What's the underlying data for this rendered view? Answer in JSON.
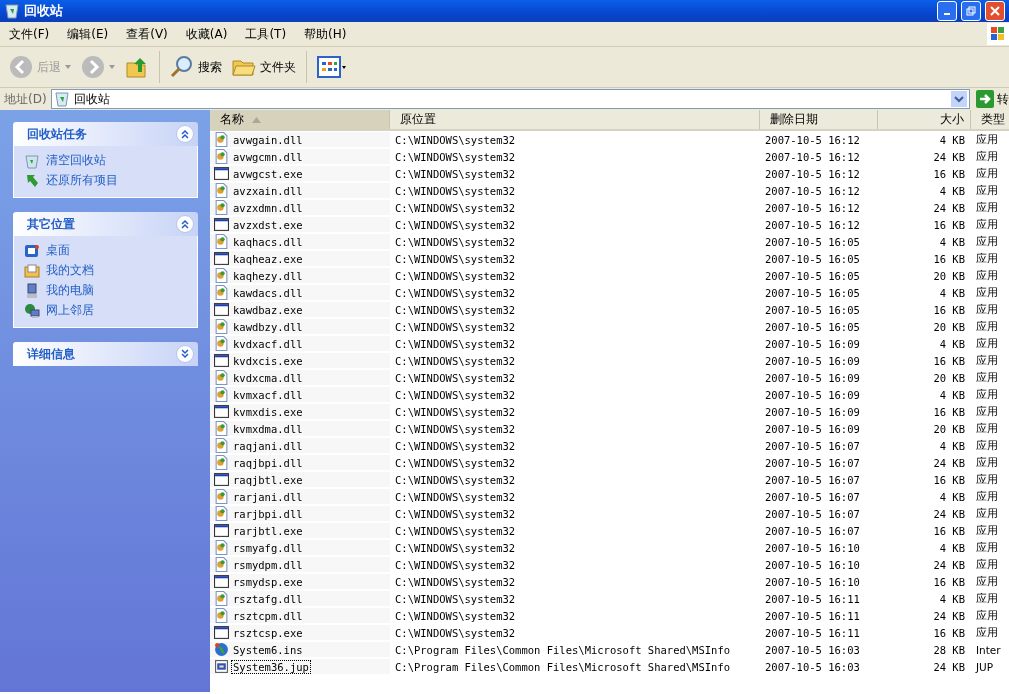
{
  "window": {
    "title": "回收站"
  },
  "menu": [
    "文件(F)",
    "编辑(E)",
    "查看(V)",
    "收藏(A)",
    "工具(T)",
    "帮助(H)"
  ],
  "toolbar": {
    "back": {
      "label": "后退",
      "disabled": true
    },
    "forward": {
      "disabled": true
    },
    "search": "搜索",
    "folders": "文件夹"
  },
  "address": {
    "label": "地址(D)",
    "value": "回收站",
    "go": "转"
  },
  "panels": [
    {
      "title": "回收站任务",
      "expanded": true,
      "items": [
        {
          "label": "清空回收站",
          "kind": "bin"
        },
        {
          "label": "还原所有项目",
          "kind": "restore"
        }
      ]
    },
    {
      "title": "其它位置",
      "expanded": true,
      "items": [
        {
          "label": "桌面",
          "kind": "desktop"
        },
        {
          "label": "我的文档",
          "kind": "documents"
        },
        {
          "label": "我的电脑",
          "kind": "computer"
        },
        {
          "label": "网上邻居",
          "kind": "network"
        }
      ]
    },
    {
      "title": "详细信息",
      "expanded": false
    }
  ],
  "table": {
    "columns": [
      {
        "label": "名称",
        "sorted": true
      },
      {
        "label": "原位置",
        "sorted": false
      },
      {
        "label": "删除日期",
        "sorted": false
      },
      {
        "label": "大小",
        "sorted": false
      },
      {
        "label": "类型",
        "sorted": false
      }
    ],
    "rows": [
      {
        "name": "avwgain.dll",
        "kind": "dll",
        "location": "C:\\WINDOWS\\system32",
        "date": "2007-10-5 16:12",
        "size": "4 KB",
        "type": "应用",
        "selected": false
      },
      {
        "name": "avwgcmn.dll",
        "kind": "dll",
        "location": "C:\\WINDOWS\\system32",
        "date": "2007-10-5 16:12",
        "size": "24 KB",
        "type": "应用",
        "selected": false
      },
      {
        "name": "avwgcst.exe",
        "kind": "exe",
        "location": "C:\\WINDOWS\\system32",
        "date": "2007-10-5 16:12",
        "size": "16 KB",
        "type": "应用",
        "selected": false
      },
      {
        "name": "avzxain.dll",
        "kind": "dll",
        "location": "C:\\WINDOWS\\system32",
        "date": "2007-10-5 16:12",
        "size": "4 KB",
        "type": "应用",
        "selected": false
      },
      {
        "name": "avzxdmn.dll",
        "kind": "dll",
        "location": "C:\\WINDOWS\\system32",
        "date": "2007-10-5 16:12",
        "size": "24 KB",
        "type": "应用",
        "selected": false
      },
      {
        "name": "avzxdst.exe",
        "kind": "exe",
        "location": "C:\\WINDOWS\\system32",
        "date": "2007-10-5 16:12",
        "size": "16 KB",
        "type": "应用",
        "selected": false
      },
      {
        "name": "kaqhacs.dll",
        "kind": "dll",
        "location": "C:\\WINDOWS\\system32",
        "date": "2007-10-5 16:05",
        "size": "4 KB",
        "type": "应用",
        "selected": false
      },
      {
        "name": "kaqheaz.exe",
        "kind": "exe",
        "location": "C:\\WINDOWS\\system32",
        "date": "2007-10-5 16:05",
        "size": "16 KB",
        "type": "应用",
        "selected": false
      },
      {
        "name": "kaqhezy.dll",
        "kind": "dll",
        "location": "C:\\WINDOWS\\system32",
        "date": "2007-10-5 16:05",
        "size": "20 KB",
        "type": "应用",
        "selected": false
      },
      {
        "name": "kawdacs.dll",
        "kind": "dll",
        "location": "C:\\WINDOWS\\system32",
        "date": "2007-10-5 16:05",
        "size": "4 KB",
        "type": "应用",
        "selected": false
      },
      {
        "name": "kawdbaz.exe",
        "kind": "exe",
        "location": "C:\\WINDOWS\\system32",
        "date": "2007-10-5 16:05",
        "size": "16 KB",
        "type": "应用",
        "selected": false
      },
      {
        "name": "kawdbzy.dll",
        "kind": "dll",
        "location": "C:\\WINDOWS\\system32",
        "date": "2007-10-5 16:05",
        "size": "20 KB",
        "type": "应用",
        "selected": false
      },
      {
        "name": "kvdxacf.dll",
        "kind": "dll",
        "location": "C:\\WINDOWS\\system32",
        "date": "2007-10-5 16:09",
        "size": "4 KB",
        "type": "应用",
        "selected": false
      },
      {
        "name": "kvdxcis.exe",
        "kind": "exe",
        "location": "C:\\WINDOWS\\system32",
        "date": "2007-10-5 16:09",
        "size": "16 KB",
        "type": "应用",
        "selected": false
      },
      {
        "name": "kvdxcma.dll",
        "kind": "dll",
        "location": "C:\\WINDOWS\\system32",
        "date": "2007-10-5 16:09",
        "size": "20 KB",
        "type": "应用",
        "selected": false
      },
      {
        "name": "kvmxacf.dll",
        "kind": "dll",
        "location": "C:\\WINDOWS\\system32",
        "date": "2007-10-5 16:09",
        "size": "4 KB",
        "type": "应用",
        "selected": false
      },
      {
        "name": "kvmxdis.exe",
        "kind": "exe",
        "location": "C:\\WINDOWS\\system32",
        "date": "2007-10-5 16:09",
        "size": "16 KB",
        "type": "应用",
        "selected": false
      },
      {
        "name": "kvmxdma.dll",
        "kind": "dll",
        "location": "C:\\WINDOWS\\system32",
        "date": "2007-10-5 16:09",
        "size": "20 KB",
        "type": "应用",
        "selected": false
      },
      {
        "name": "raqjani.dll",
        "kind": "dll",
        "location": "C:\\WINDOWS\\system32",
        "date": "2007-10-5 16:07",
        "size": "4 KB",
        "type": "应用",
        "selected": false
      },
      {
        "name": "raqjbpi.dll",
        "kind": "dll",
        "location": "C:\\WINDOWS\\system32",
        "date": "2007-10-5 16:07",
        "size": "24 KB",
        "type": "应用",
        "selected": false
      },
      {
        "name": "raqjbtl.exe",
        "kind": "exe",
        "location": "C:\\WINDOWS\\system32",
        "date": "2007-10-5 16:07",
        "size": "16 KB",
        "type": "应用",
        "selected": false
      },
      {
        "name": "rarjani.dll",
        "kind": "dll",
        "location": "C:\\WINDOWS\\system32",
        "date": "2007-10-5 16:07",
        "size": "4 KB",
        "type": "应用",
        "selected": false
      },
      {
        "name": "rarjbpi.dll",
        "kind": "dll",
        "location": "C:\\WINDOWS\\system32",
        "date": "2007-10-5 16:07",
        "size": "24 KB",
        "type": "应用",
        "selected": false
      },
      {
        "name": "rarjbtl.exe",
        "kind": "exe",
        "location": "C:\\WINDOWS\\system32",
        "date": "2007-10-5 16:07",
        "size": "16 KB",
        "type": "应用",
        "selected": false
      },
      {
        "name": "rsmyafg.dll",
        "kind": "dll",
        "location": "C:\\WINDOWS\\system32",
        "date": "2007-10-5 16:10",
        "size": "4 KB",
        "type": "应用",
        "selected": false
      },
      {
        "name": "rsmydpm.dll",
        "kind": "dll",
        "location": "C:\\WINDOWS\\system32",
        "date": "2007-10-5 16:10",
        "size": "24 KB",
        "type": "应用",
        "selected": false
      },
      {
        "name": "rsmydsp.exe",
        "kind": "exe",
        "location": "C:\\WINDOWS\\system32",
        "date": "2007-10-5 16:10",
        "size": "16 KB",
        "type": "应用",
        "selected": false
      },
      {
        "name": "rsztafg.dll",
        "kind": "dll",
        "location": "C:\\WINDOWS\\system32",
        "date": "2007-10-5 16:11",
        "size": "4 KB",
        "type": "应用",
        "selected": false
      },
      {
        "name": "rsztcpm.dll",
        "kind": "dll",
        "location": "C:\\WINDOWS\\system32",
        "date": "2007-10-5 16:11",
        "size": "24 KB",
        "type": "应用",
        "selected": false
      },
      {
        "name": "rsztcsp.exe",
        "kind": "exe",
        "location": "C:\\WINDOWS\\system32",
        "date": "2007-10-5 16:11",
        "size": "16 KB",
        "type": "应用",
        "selected": false
      },
      {
        "name": "System6.ins",
        "kind": "ins",
        "location": "C:\\Program Files\\Common Files\\Microsoft Shared\\MSInfo",
        "date": "2007-10-5 16:03",
        "size": "28 KB",
        "type": "Inter",
        "selected": false
      },
      {
        "name": "System36.jup",
        "kind": "jup",
        "location": "C:\\Program Files\\Common Files\\Microsoft Shared\\MSInfo",
        "date": "2007-10-5 16:03",
        "size": "24 KB",
        "type": "JUP",
        "selected": true
      }
    ]
  }
}
